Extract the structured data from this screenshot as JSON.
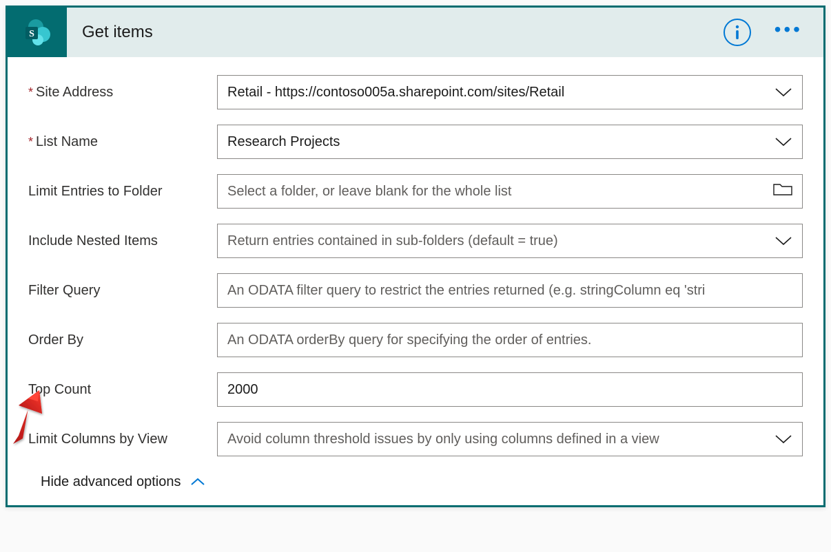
{
  "header": {
    "title": "Get items"
  },
  "fields": {
    "site_address": {
      "label": "Site Address",
      "required": true,
      "value": "Retail - https://contoso005a.sharepoint.com/sites/Retail"
    },
    "list_name": {
      "label": "List Name",
      "required": true,
      "value": "Research Projects"
    },
    "limit_folder": {
      "label": "Limit Entries to Folder",
      "placeholder": "Select a folder, or leave blank for the whole list"
    },
    "include_nested": {
      "label": "Include Nested Items",
      "placeholder": "Return entries contained in sub-folders (default = true)"
    },
    "filter_query": {
      "label": "Filter Query",
      "placeholder": "An ODATA filter query to restrict the entries returned (e.g. stringColumn eq 'stri"
    },
    "order_by": {
      "label": "Order By",
      "placeholder": "An ODATA orderBy query for specifying the order of entries."
    },
    "top_count": {
      "label": "Top Count",
      "value": "2000"
    },
    "limit_columns": {
      "label": "Limit Columns by View",
      "placeholder": "Avoid column threshold issues by only using columns defined in a view"
    }
  },
  "footer": {
    "toggle_label": "Hide advanced options"
  },
  "colors": {
    "accent_teal": "#036c70",
    "link_blue": "#0078d4"
  }
}
